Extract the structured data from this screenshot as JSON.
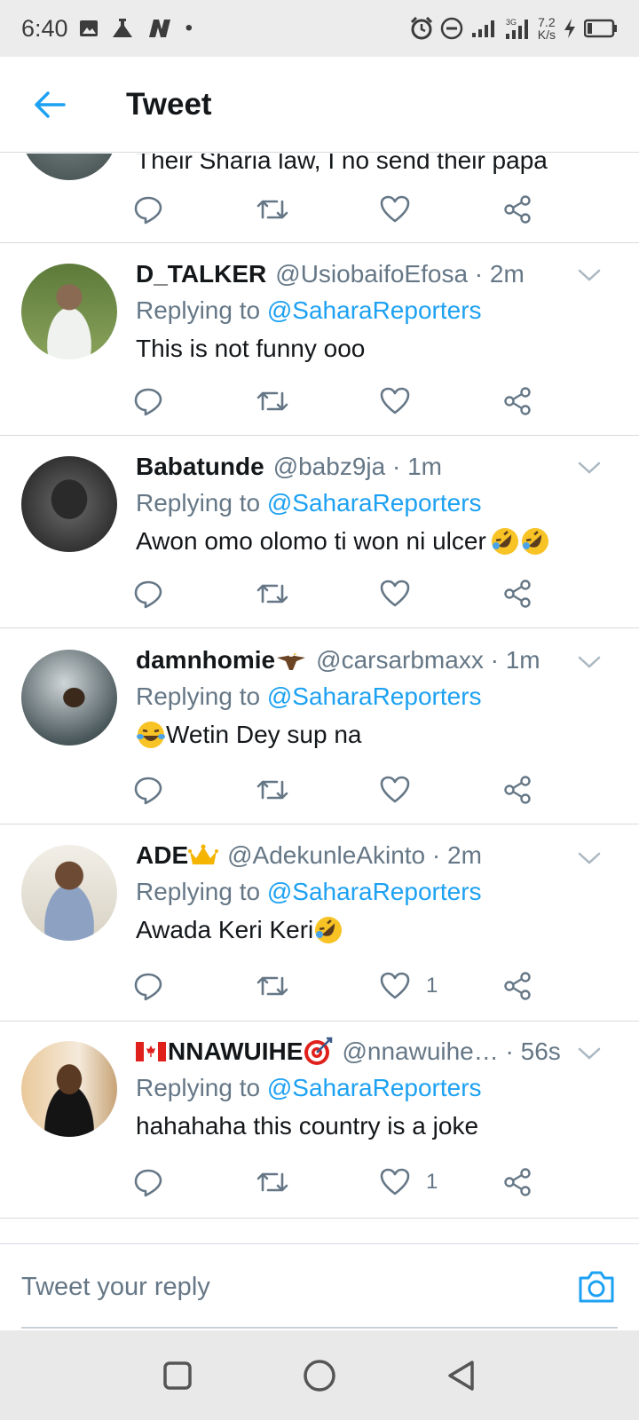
{
  "status_bar": {
    "time": "6:40",
    "dot": "•",
    "net_speed_value": "7.2",
    "net_speed_unit": "K/s",
    "icons": [
      "image-icon",
      "flask-icon",
      "n-app-icon",
      "alarm-icon",
      "dnd-icon",
      "signal-icon",
      "signal-3g-icon",
      "charging-icon",
      "battery-icon"
    ]
  },
  "header": {
    "title": "Tweet"
  },
  "reply_prefix": "Replying to",
  "reply_target": "@SaharaReporters",
  "partial_tweet": {
    "text": "Their Sharia law, I no send their papa"
  },
  "tweets": [
    {
      "name": "D_TALKER",
      "meta": "@UsiobaifoEfosa · 2m",
      "text": "This is not funny ooo",
      "likes": ""
    },
    {
      "name": "Babatunde",
      "meta": "@babz9ja · 1m",
      "text": "Awon omo olomo ti won ni ulcer ",
      "likes": ""
    },
    {
      "name": "damnhomie",
      "meta": "@carsarbmaxx · 1m",
      "text": "Wetin Dey sup na",
      "likes": ""
    },
    {
      "name": "ADE",
      "meta": "@AdekunleAkinto · 2m",
      "text": "Awada Keri Keri",
      "likes": "1"
    },
    {
      "name": "NNAWUIHE ",
      "meta": "@nnawuihe…  · 56s",
      "text": "hahahaha this country is a joke",
      "likes": "1"
    }
  ],
  "reply_bar": {
    "placeholder": "Tweet your reply"
  },
  "colors": {
    "accent": "#1da1f2",
    "secondary_text": "#657786",
    "divider": "#d6dbe0"
  }
}
